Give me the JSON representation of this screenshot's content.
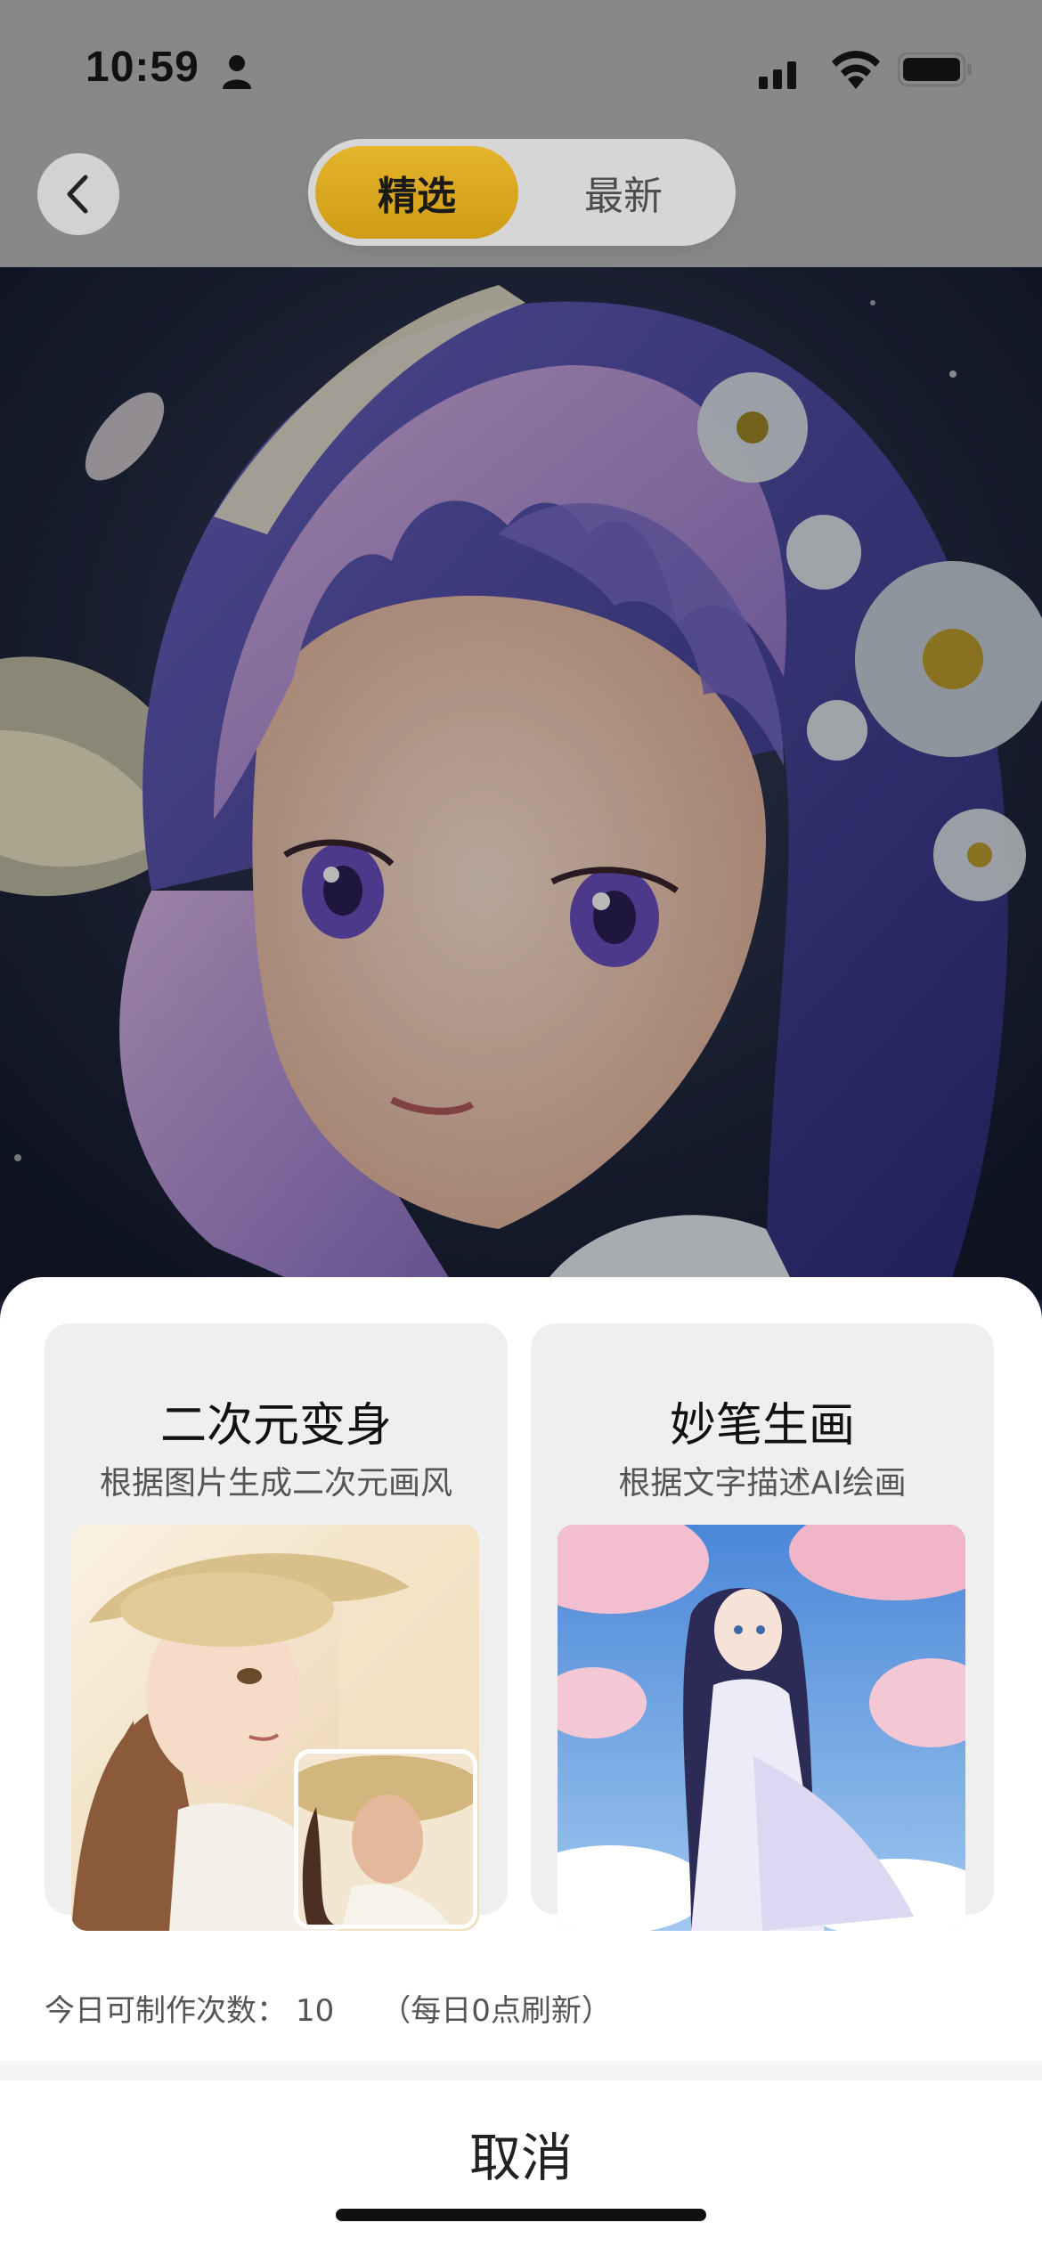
{
  "status_bar": {
    "time": "10:59"
  },
  "nav": {
    "back_icon": "chevron-left-icon",
    "tabs": [
      {
        "label": "精选",
        "active": true
      },
      {
        "label": "最新",
        "active": false
      }
    ],
    "accent_color": "#d9a81e"
  },
  "sheet": {
    "cards": [
      {
        "title": "二次元变身",
        "subtitle": "根据图片生成二次元画风"
      },
      {
        "title": "妙笔生画",
        "subtitle": "根据文字描述AI绘画"
      }
    ],
    "quota": {
      "label": "今日可制作次数：",
      "count": "10",
      "note": "（每日0点刷新）"
    },
    "cancel_label": "取消"
  }
}
